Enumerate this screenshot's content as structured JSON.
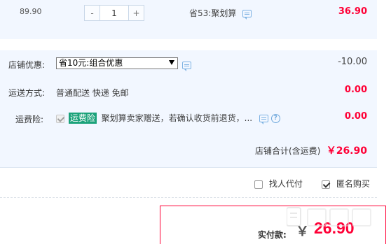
{
  "item": {
    "unit_price": "89.90",
    "quantity": "1",
    "minus": "-",
    "plus": "+",
    "savings": "省53:聚划算",
    "subtotal": "36.90"
  },
  "shop_discount": {
    "label": "店铺优惠:",
    "selected": "省10元:组合优惠",
    "value": "-10.00"
  },
  "shipping": {
    "label": "运送方式:",
    "value": "普通配送 快递 免邮",
    "amount": "0.00"
  },
  "insurance": {
    "label": "运费险:",
    "badge": "运费险",
    "text": "聚划算卖家赠送，若确认收货前退货，...",
    "amount": "0.00"
  },
  "shop_total": {
    "label": "店铺合计(含运费)",
    "value": "￥26.90"
  },
  "options": {
    "proxy_pay": "找人代付",
    "anonymous": "匿名购买"
  },
  "payment": {
    "label": "实付款:",
    "currency": "￥",
    "amount": "26.90"
  },
  "colors": {
    "accent_red": "#ff0036",
    "band_bg": "#f2f7ff",
    "badge_green": "#1ba27a"
  }
}
